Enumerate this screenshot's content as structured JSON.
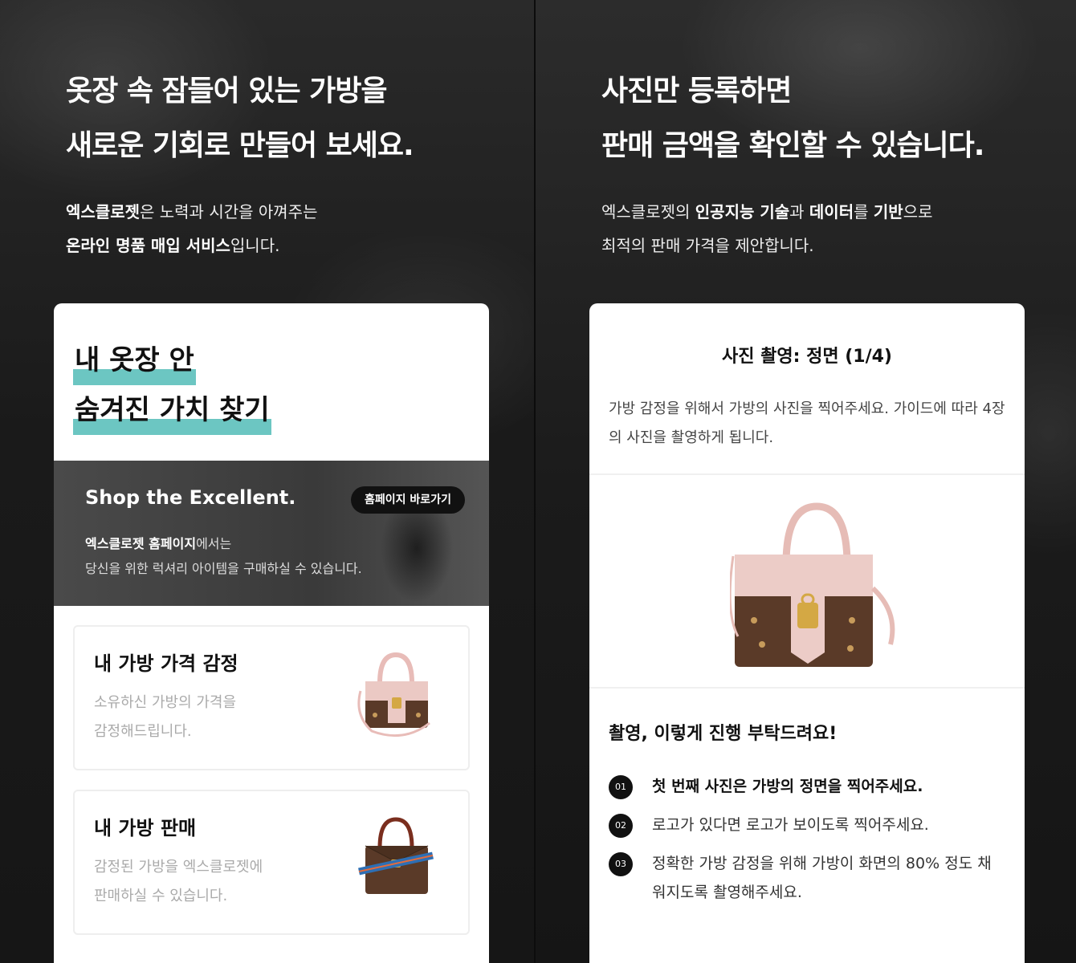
{
  "left": {
    "hero_line1": "옷장 속 잠들어 있는 가방을",
    "hero_line2": "새로운 기회로 만들어 보세요.",
    "desc1_bold": "엑스클로젯",
    "desc1_rest": "은 노력과 시간을 아껴주는",
    "desc2_bold": "온라인 명품 매입 서비스",
    "desc2_rest": "입니다.",
    "card": {
      "title_line1": "내 옷장 안",
      "title_line2": "숨겨진 가치 찾기",
      "banner": {
        "title": "Shop the Excellent.",
        "button": "홈페이지 바로가기",
        "desc1_bold": "엑스클로젯 홈페이지",
        "desc1_rest": "에서는",
        "desc2": "당신을 위한 럭셔리 아이템을 구매하실 수 있습니다."
      },
      "menu": [
        {
          "title": "내 가방 가격 감정",
          "desc1": "소유하신 가방의 가격을",
          "desc2": "감정해드립니다."
        },
        {
          "title": "내 가방 판매",
          "desc1": "감정된 가방을 엑스클로젯에",
          "desc2": "판매하실 수 있습니다."
        }
      ]
    }
  },
  "right": {
    "hero_line1": "사진만 등록하면",
    "hero_line2": "판매 금액을 확인할 수 있습니다.",
    "desc1_a": "엑스클로젯의 ",
    "desc1_bold1": "인공지능 기술",
    "desc1_b": "과 ",
    "desc1_bold2": "데이터",
    "desc1_c": "를 ",
    "desc1_bold3": "기반",
    "desc1_d": "으로",
    "desc2": "최적의 판매 가격을 제안합니다.",
    "card": {
      "step_title": "사진 촬영: 정면 (1/4)",
      "step_desc": "가방 감정을 위해서 가방의 사진을 찍어주세요. 가이드에 따라 4장의 사진을 촬영하게 됩니다.",
      "guide_title": "촬영, 이렇게 진행 부탁드려요!",
      "guides": [
        {
          "num": "01",
          "text": "첫 번째 사진은 가방의 정면을 찍어주세요."
        },
        {
          "num": "02",
          "text": "로고가 있다면 로고가 보이도록 찍어주세요."
        },
        {
          "num": "03",
          "text": "정확한 가방 감정을 위해 가방이 화면의 80% 정도 채워지도록 촬영해주세요."
        }
      ]
    }
  },
  "colors": {
    "highlight": "#6cc6c2",
    "background": "#1a1a1a",
    "bag_pink": "#e8c4c0",
    "bag_monogram": "#5a3a28"
  },
  "icons": [
    "pink-monogram-bag-icon",
    "brown-monogram-bag-icon"
  ]
}
